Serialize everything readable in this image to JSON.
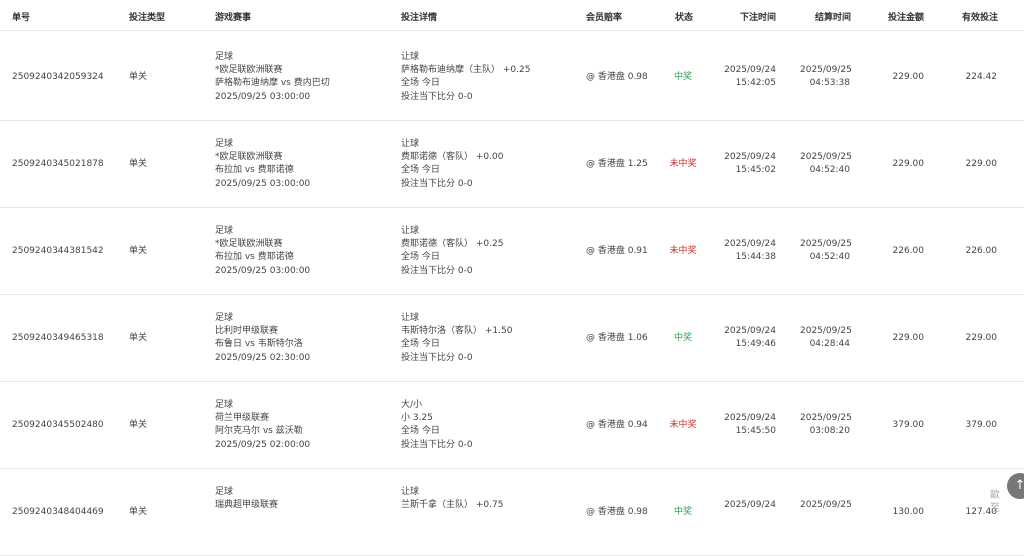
{
  "headers": {
    "id": "单号",
    "type": "投注类型",
    "game": "游戏赛事",
    "detail": "投注详情",
    "odds": "会员赔率",
    "status": "状态",
    "bet_time": "下注时间",
    "settle_time": "结算时间",
    "amount": "投注金额",
    "valid": "有效投注"
  },
  "rows": [
    {
      "id": "2509240342059324",
      "type": "单关",
      "sport": "足球",
      "league": "*欧足联欧洲联赛",
      "match": "萨格勒布迪纳摩 vs 费内巴切",
      "match_time": "2025/09/25 03:00:00",
      "bet_kind": "让球",
      "selection": "萨格勒布迪纳摩（主队） +0.25",
      "period": "全场 今日",
      "score": "投注当下比分 0-0",
      "odds": "@ 香港盘 0.98",
      "status": "中奖",
      "status_type": "win",
      "bet_date": "2025/09/24",
      "bet_clock": "15:42:05",
      "settle_date": "2025/09/25",
      "settle_clock": "04:53:38",
      "amount": "229.00",
      "valid": "224.42"
    },
    {
      "id": "2509240345021878",
      "type": "单关",
      "sport": "足球",
      "league": "*欧足联欧洲联赛",
      "match": "布拉加 vs 费耶诺德",
      "match_time": "2025/09/25 03:00:00",
      "bet_kind": "让球",
      "selection": "费耶诺德（客队） +0.00",
      "period": "全场 今日",
      "score": "投注当下比分 0-0",
      "odds": "@ 香港盘 1.25",
      "status": "未中奖",
      "status_type": "lose",
      "bet_date": "2025/09/24",
      "bet_clock": "15:45:02",
      "settle_date": "2025/09/25",
      "settle_clock": "04:52:40",
      "amount": "229.00",
      "valid": "229.00"
    },
    {
      "id": "2509240344381542",
      "type": "单关",
      "sport": "足球",
      "league": "*欧足联欧洲联赛",
      "match": "布拉加 vs 费耶诺德",
      "match_time": "2025/09/25 03:00:00",
      "bet_kind": "让球",
      "selection": "费耶诺德（客队） +0.25",
      "period": "全场 今日",
      "score": "投注当下比分 0-0",
      "odds": "@ 香港盘 0.91",
      "status": "未中奖",
      "status_type": "lose",
      "bet_date": "2025/09/24",
      "bet_clock": "15:44:38",
      "settle_date": "2025/09/25",
      "settle_clock": "04:52:40",
      "amount": "226.00",
      "valid": "226.00"
    },
    {
      "id": "2509240349465318",
      "type": "单关",
      "sport": "足球",
      "league": "比利时甲级联赛",
      "match": "布鲁日 vs 韦斯特尔洛",
      "match_time": "2025/09/25 02:30:00",
      "bet_kind": "让球",
      "selection": "韦斯特尔洛（客队） +1.50",
      "period": "全场 今日",
      "score": "投注当下比分 0-0",
      "odds": "@ 香港盘 1.06",
      "status": "中奖",
      "status_type": "win",
      "bet_date": "2025/09/24",
      "bet_clock": "15:49:46",
      "settle_date": "2025/09/25",
      "settle_clock": "04:28:44",
      "amount": "229.00",
      "valid": "229.00"
    },
    {
      "id": "2509240345502480",
      "type": "单关",
      "sport": "足球",
      "league": "荷兰甲级联赛",
      "match": "阿尔克马尔 vs 兹沃勒",
      "match_time": "2025/09/25 02:00:00",
      "bet_kind": "大/小",
      "selection": "小 3.25",
      "period": "全场 今日",
      "score": "投注当下比分 0-0",
      "odds": "@ 香港盘 0.94",
      "status": "未中奖",
      "status_type": "lose",
      "bet_date": "2025/09/24",
      "bet_clock": "15:45:50",
      "settle_date": "2025/09/25",
      "settle_clock": "03:08:20",
      "amount": "379.00",
      "valid": "379.00"
    },
    {
      "id": "2509240348404469",
      "type": "单关",
      "sport": "足球",
      "league": "瑞典超甲级联赛",
      "match": "",
      "match_time": "",
      "bet_kind": "让球",
      "selection": "兰斯千拿（主队） +0.75",
      "period": "",
      "score": "",
      "odds": "@ 香港盘 0.98",
      "status": "中奖",
      "status_type": "win",
      "bet_date": "2025/09/24",
      "bet_clock": "",
      "settle_date": "2025/09/25",
      "settle_clock": "",
      "amount": "130.00",
      "valid": "127.40"
    }
  ],
  "scroll_top_icon": "arrow-up-icon",
  "watermark_lines": [
    "歐",
    "至"
  ]
}
